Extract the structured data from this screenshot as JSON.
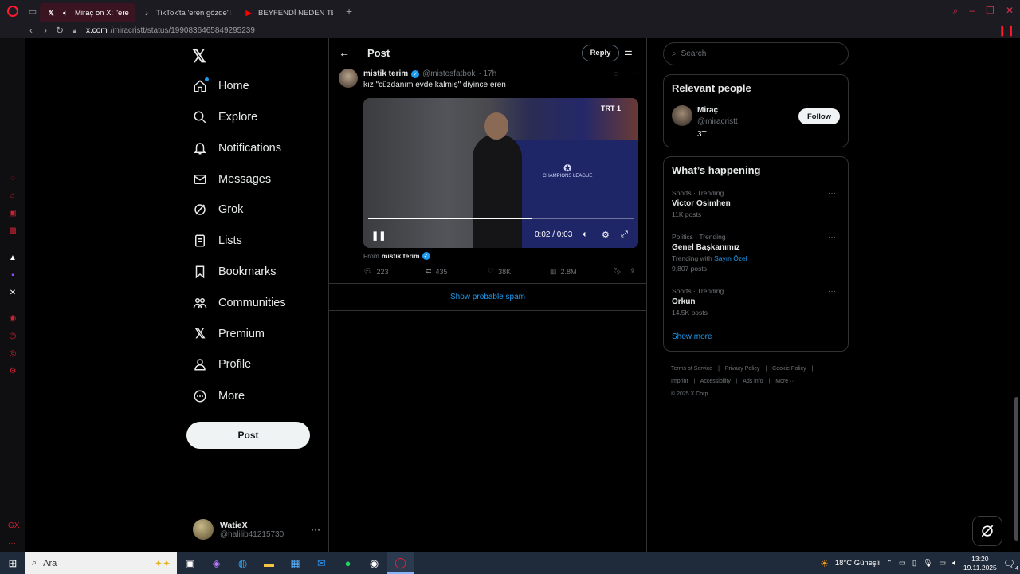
{
  "browser": {
    "tabs": [
      {
        "label": "Miraç on X: \"eren king",
        "active": true,
        "icon": "x-icon"
      },
      {
        "label": "TikTok'ta 'eren gözde' bu",
        "active": false,
        "icon": "tiktok-icon"
      },
      {
        "label": "BEYFENDİ NEDEN TERÖR",
        "active": false,
        "icon": "youtube-icon"
      }
    ],
    "url_domain": "x.com",
    "url_path": "/miracristt/status/1990836465849295239"
  },
  "nav": {
    "items": [
      {
        "label": "Home",
        "icon": "home-icon"
      },
      {
        "label": "Explore",
        "icon": "search-icon"
      },
      {
        "label": "Notifications",
        "icon": "bell-icon"
      },
      {
        "label": "Messages",
        "icon": "mail-icon"
      },
      {
        "label": "Grok",
        "icon": "grok-icon"
      },
      {
        "label": "Lists",
        "icon": "list-icon"
      },
      {
        "label": "Bookmarks",
        "icon": "bookmark-icon"
      },
      {
        "label": "Communities",
        "icon": "people-icon"
      },
      {
        "label": "Premium",
        "icon": "x-icon"
      },
      {
        "label": "Profile",
        "icon": "person-icon"
      },
      {
        "label": "More",
        "icon": "more-circle-icon"
      }
    ],
    "post_button": "Post",
    "account": {
      "name": "WatieX",
      "handle": "@halilib41215730"
    }
  },
  "main": {
    "title": "Post",
    "reply_button": "Reply",
    "tweet": {
      "name": "mistik terim",
      "handle": "@mistosfatbok",
      "time": "· 17h",
      "text": "kız \"cüzdanım evde kalmış\" diyince eren",
      "video": {
        "channel_badge": "TRT 1",
        "time_display": "0:02 / 0:03",
        "progress": 0.62,
        "watermark": "CHAMPIONS LEAGUE"
      },
      "from_prefix": "From",
      "from_name": "mistik terim",
      "stats": {
        "replies": "223",
        "reposts": "435",
        "likes": "38K",
        "views": "2.8M"
      }
    },
    "spam_link": "Show probable spam"
  },
  "right": {
    "search_placeholder": "Search",
    "relevant_people": {
      "title": "Relevant people",
      "person": {
        "name": "Miraç",
        "handle": "@miracristt",
        "bio": "3T",
        "follow": "Follow"
      }
    },
    "whats_happening": {
      "title": "What’s happening",
      "trends": [
        {
          "meta": "Sports · Trending",
          "name": "Victor Osimhen",
          "sub_prefix": "",
          "sub_link": "",
          "count": "11K posts"
        },
        {
          "meta": "Politics · Trending",
          "name": "Genel Başkanımız",
          "sub_prefix": "Trending with",
          "sub_link": "Sayın Özel",
          "count": "9,807 posts"
        },
        {
          "meta": "Sports · Trending",
          "name": "Orkun",
          "sub_prefix": "",
          "sub_link": "",
          "count": "14.5K posts"
        }
      ],
      "show_more": "Show more"
    },
    "footer": {
      "line1": [
        "Terms of Service",
        "|",
        "Privacy Policy",
        "|",
        "Cookie Policy",
        "|"
      ],
      "line2": [
        "Imprint",
        "|",
        "Accessibility",
        "|",
        "Ads info",
        "|",
        "More ···"
      ],
      "line3": "© 2025 X Corp."
    }
  },
  "taskbar": {
    "search_placeholder": "Ara",
    "weather": "18°C  Güneşli",
    "time": "13:20",
    "date": "19.11.2025",
    "notif_count": "4"
  },
  "colors": {
    "accent": "#1d9bf0",
    "opera": "#ff1b2d",
    "background": "#000000"
  }
}
